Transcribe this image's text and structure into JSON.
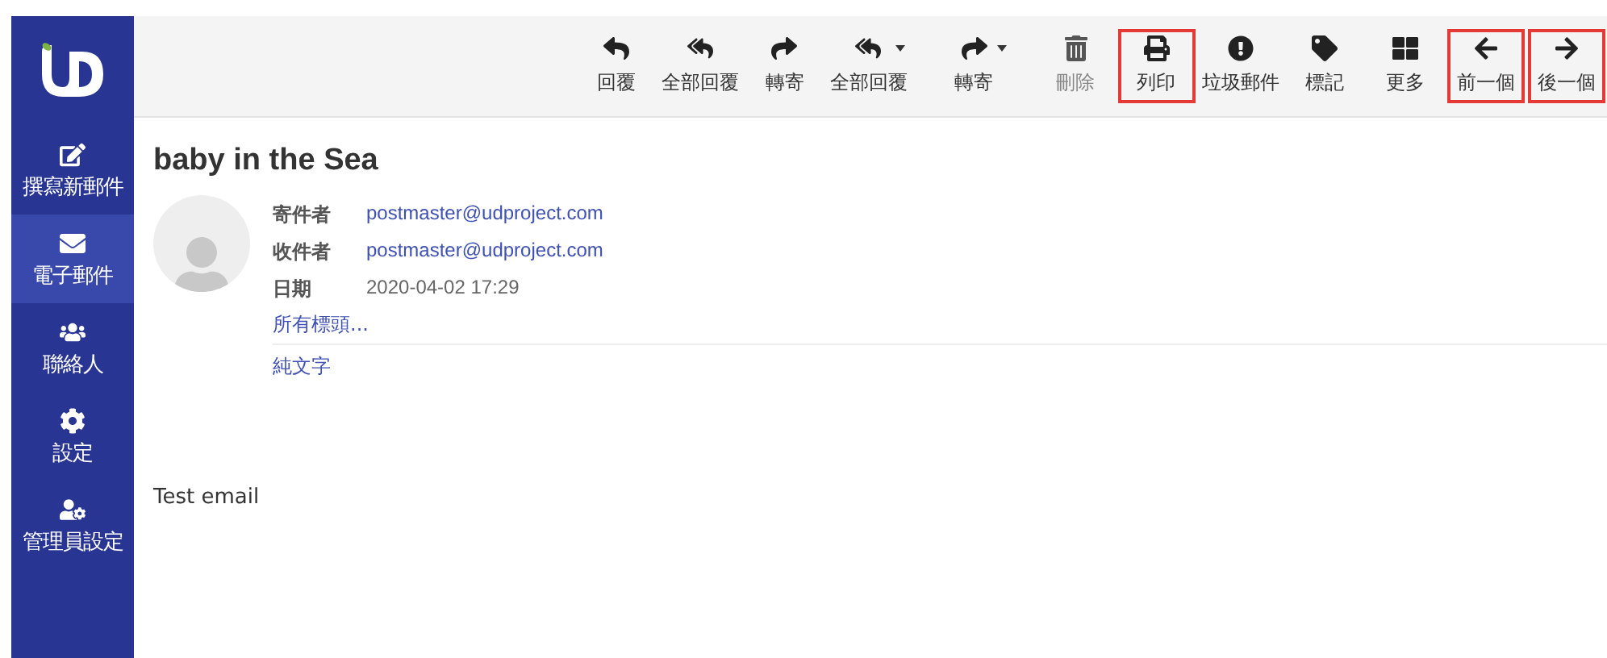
{
  "sidebar": {
    "items": [
      {
        "label": "撰寫新郵件",
        "selected": false
      },
      {
        "label": "電子郵件",
        "selected": true
      },
      {
        "label": "聯絡人",
        "selected": false
      },
      {
        "label": "設定",
        "selected": false
      },
      {
        "label": "管理員設定",
        "selected": false
      }
    ]
  },
  "toolbar": {
    "buttons": [
      {
        "label": "回覆",
        "disabled": false,
        "dropdown": false,
        "highlighted": false
      },
      {
        "label": "全部回覆",
        "disabled": false,
        "dropdown": false,
        "highlighted": false
      },
      {
        "label": "轉寄",
        "disabled": false,
        "dropdown": false,
        "highlighted": false
      },
      {
        "label": "全部回覆",
        "disabled": false,
        "dropdown": true,
        "highlighted": false
      },
      {
        "label": "轉寄",
        "disabled": false,
        "dropdown": true,
        "highlighted": false
      },
      {
        "label": "刪除",
        "disabled": true,
        "dropdown": false,
        "highlighted": false
      },
      {
        "label": "列印",
        "disabled": false,
        "dropdown": false,
        "highlighted": true
      },
      {
        "label": "垃圾郵件",
        "disabled": false,
        "dropdown": false,
        "highlighted": false
      },
      {
        "label": "標記",
        "disabled": false,
        "dropdown": false,
        "highlighted": false
      },
      {
        "label": "更多",
        "disabled": false,
        "dropdown": false,
        "highlighted": false
      },
      {
        "label": "前一個",
        "disabled": false,
        "dropdown": false,
        "highlighted": true
      },
      {
        "label": "後一個",
        "disabled": false,
        "dropdown": false,
        "highlighted": true
      }
    ]
  },
  "message": {
    "subject": "baby in the Sea",
    "headers": [
      {
        "label": "寄件者",
        "value": "postmaster@udproject.com",
        "kind": "link"
      },
      {
        "label": "收件者",
        "value": "postmaster@udproject.com",
        "kind": "link"
      },
      {
        "label": "日期",
        "value": "2020-04-02 17:29",
        "kind": "text"
      }
    ],
    "all_headers_link": "所有標頭...",
    "plain_text_link": "純文字",
    "body": "Test email"
  }
}
